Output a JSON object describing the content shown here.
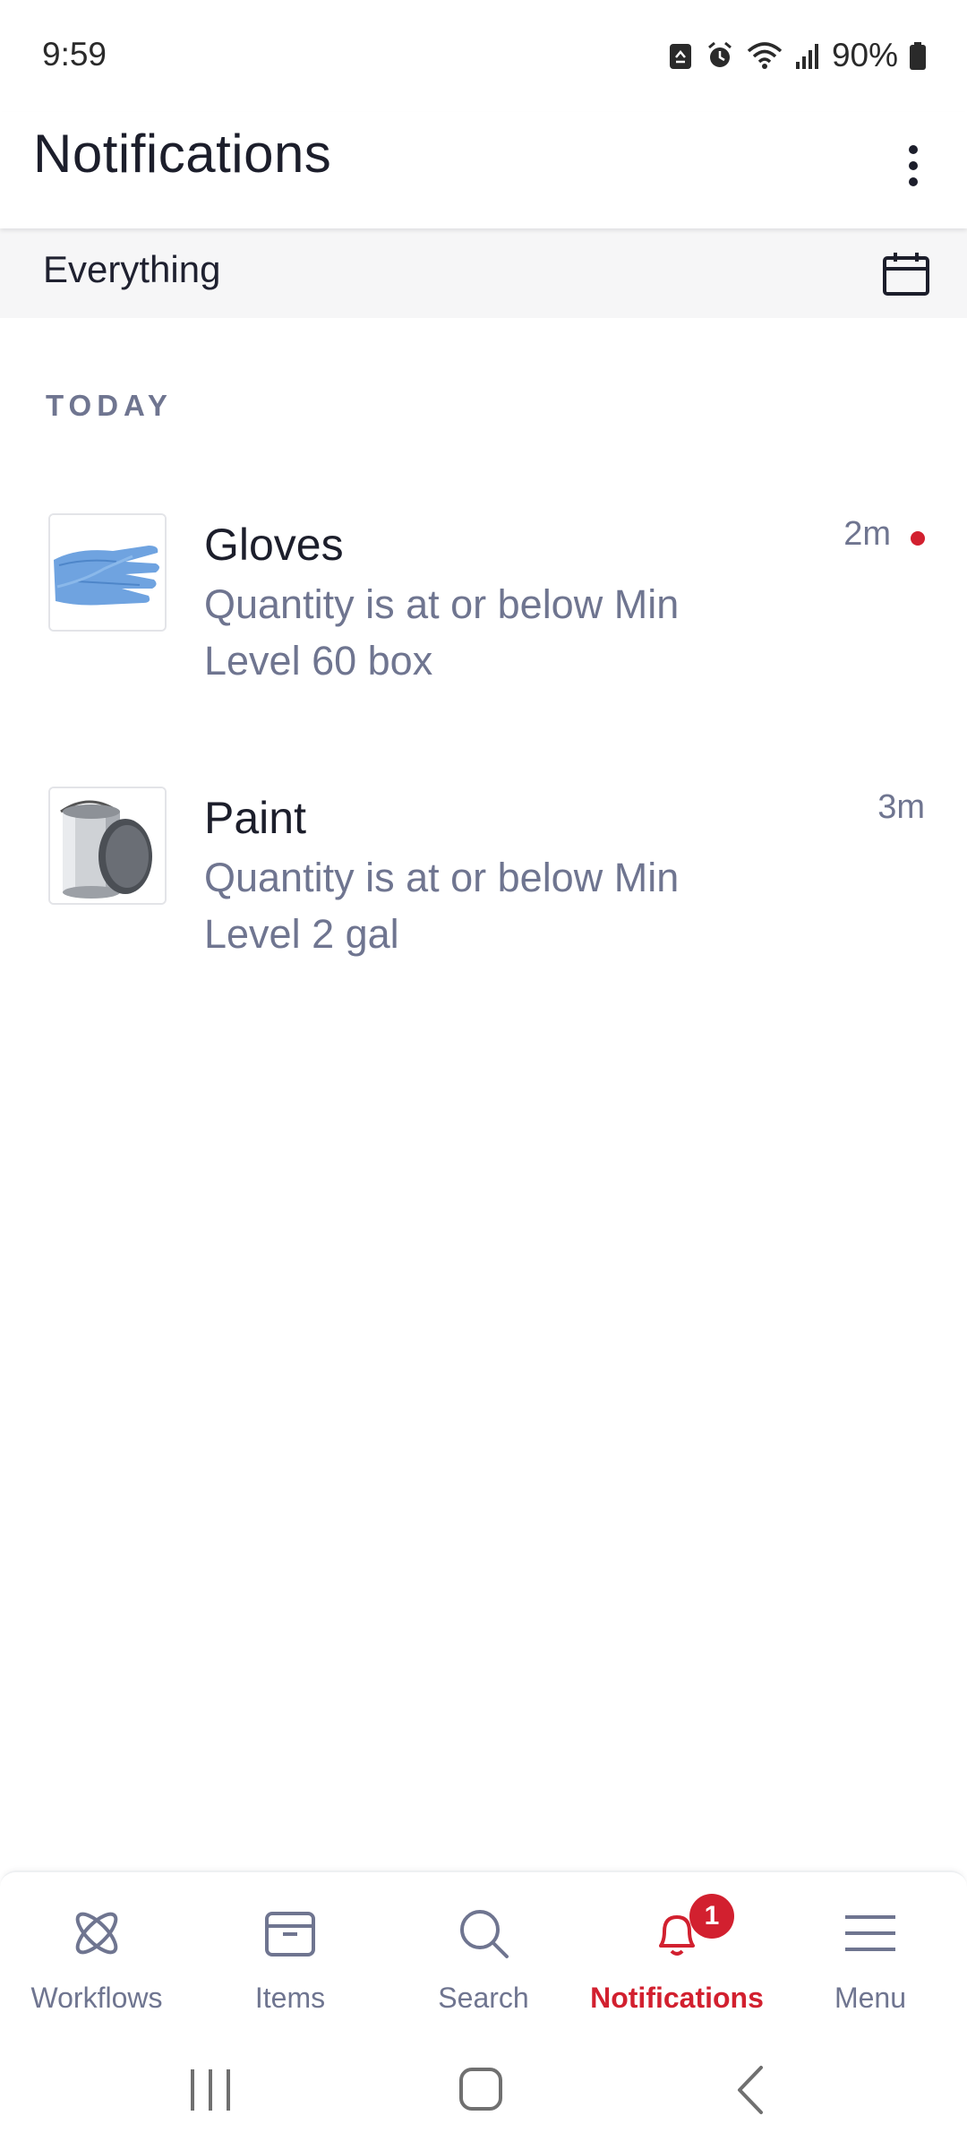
{
  "status_bar": {
    "time": "9:59",
    "battery_percent": "90%",
    "icons": [
      "recycle-icon",
      "alarm-icon",
      "wifi-icon",
      "signal-icon",
      "battery-icon"
    ]
  },
  "app_bar": {
    "title": "Notifications",
    "more_icon": "more-vertical-icon"
  },
  "filter": {
    "label": "Everything",
    "calendar_icon": "calendar-icon"
  },
  "sections": [
    {
      "header": "TODAY",
      "items": [
        {
          "title": "Gloves",
          "body": "Quantity is at or below Min Level 60 box",
          "time": "2m",
          "unread": true,
          "thumbnail": "blue-gloves-image"
        },
        {
          "title": "Paint",
          "body": "Quantity is at or below Min Level 2 gal",
          "time": "3m",
          "unread": false,
          "thumbnail": "paint-can-image"
        }
      ]
    }
  ],
  "bottom_nav": {
    "items": [
      {
        "label": "Workflows",
        "icon": "workflows-icon"
      },
      {
        "label": "Items",
        "icon": "box-icon"
      },
      {
        "label": "Search",
        "icon": "search-icon"
      },
      {
        "label": "Notifications",
        "icon": "bell-icon",
        "badge": "1",
        "active": true
      },
      {
        "label": "Menu",
        "icon": "hamburger-icon"
      }
    ]
  },
  "colors": {
    "accent": "#d2202f",
    "muted_text": "#6f7590",
    "primary_text": "#1c1e2b",
    "filter_bg": "#f6f6f7"
  }
}
